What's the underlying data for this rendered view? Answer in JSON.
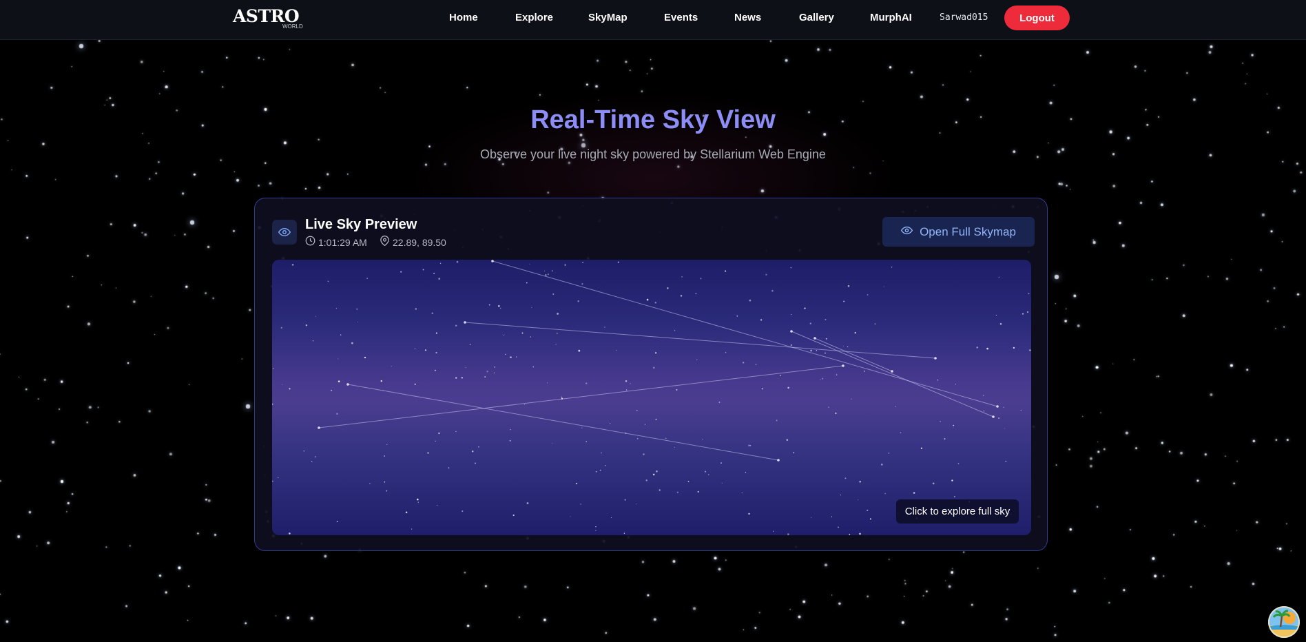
{
  "logo": {
    "main": "ASTRO",
    "sub": "WORLD"
  },
  "nav": {
    "items": [
      "Home",
      "Explore",
      "SkyMap",
      "Events",
      "News",
      "Gallery",
      "MurphAI"
    ],
    "username": "Sarwad015",
    "logout_label": "Logout"
  },
  "hero": {
    "title": "Real-Time Sky View",
    "subtitle": "Observe your live night sky powered by Stellarium Web Engine"
  },
  "card": {
    "title": "Live Sky Preview",
    "time": "1:01:29 AM",
    "coords": "22.89, 89.50",
    "open_button": "Open Full Skymap",
    "explore_hint": "Click to explore full sky"
  },
  "icons": {
    "card_icon": "eye-icon",
    "time_icon": "clock-icon",
    "location_icon": "map-pin-icon",
    "button_icon": "eye-icon",
    "avatar_icon": "beach-avatar"
  },
  "colors": {
    "accent": "#8d8df6",
    "logout": "#ee2b3b",
    "button_text": "#8fb4f8"
  }
}
